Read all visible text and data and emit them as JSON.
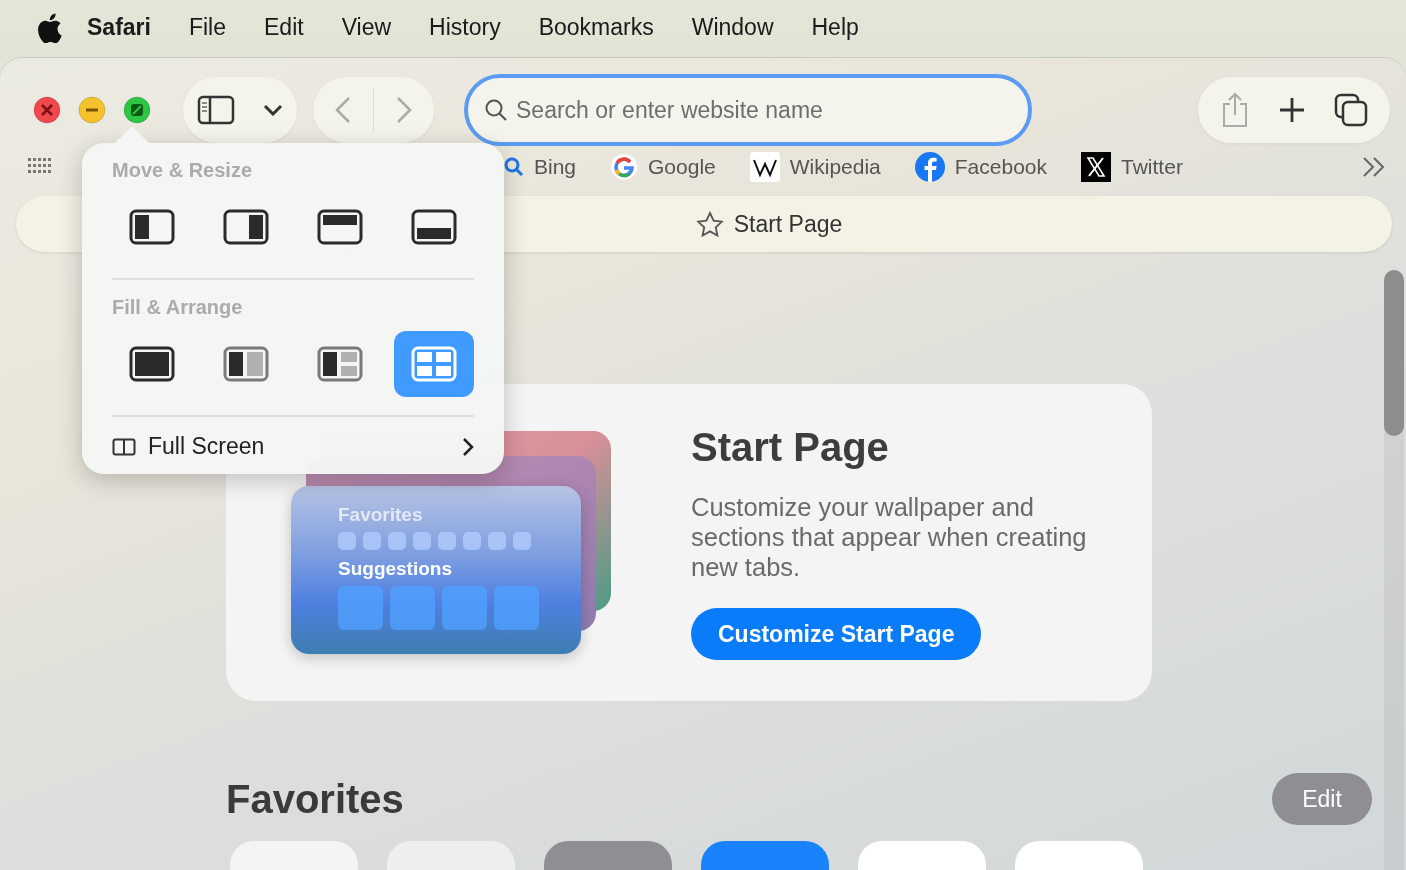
{
  "menu_bar": {
    "items": [
      {
        "label": "Safari",
        "kind": "app"
      },
      {
        "label": "File",
        "kind": "menu"
      },
      {
        "label": "Edit",
        "kind": "menu"
      },
      {
        "label": "View",
        "kind": "menu"
      },
      {
        "label": "History",
        "kind": "menu"
      },
      {
        "label": "Bookmarks",
        "kind": "menu"
      },
      {
        "label": "Window",
        "kind": "menu"
      },
      {
        "label": "Help",
        "kind": "menu"
      }
    ]
  },
  "toolbar": {
    "search": {
      "placeholder": "Search or enter website name"
    }
  },
  "favorites_bar": {
    "items": [
      {
        "label": "Bing",
        "kind": "search"
      },
      {
        "label": "Google",
        "kind": "google"
      },
      {
        "label": "Wikipedia",
        "kind": "wiki"
      },
      {
        "label": "Facebook",
        "kind": "facebook"
      },
      {
        "label": "Twitter",
        "kind": "x"
      }
    ]
  },
  "tab": {
    "title": "Start Page"
  },
  "window_menu": {
    "sections": [
      {
        "title": "Move & Resize",
        "options": [
          {
            "kind": "left",
            "selected": false
          },
          {
            "kind": "right",
            "selected": false
          },
          {
            "kind": "top",
            "selected": false
          },
          {
            "kind": "bottom",
            "selected": false
          }
        ]
      },
      {
        "title": "Fill & Arrange",
        "options": [
          {
            "kind": "fill",
            "selected": false
          },
          {
            "kind": "halves",
            "selected": false
          },
          {
            "kind": "thirds",
            "selected": false
          },
          {
            "kind": "quarters",
            "selected": true
          }
        ]
      }
    ],
    "full_screen": {
      "label": "Full Screen"
    }
  },
  "start_card": {
    "illustration": {
      "favorites_label": "Favorites",
      "suggestions_label": "Suggestions"
    },
    "title": "Start Page",
    "description": "Customize your wallpaper and sections that appear when creating new tabs.",
    "button": "Customize Start Page"
  },
  "favorites": {
    "title": "Favorites",
    "edit_button": "Edit",
    "tiles": [
      {
        "color": "#f4f4f2"
      },
      {
        "color": "#eeeeec"
      },
      {
        "color": "#8e8e93"
      },
      {
        "color": "#1a82fb"
      },
      {
        "color": "#ffffff"
      },
      {
        "color": "#ffffff"
      }
    ]
  }
}
